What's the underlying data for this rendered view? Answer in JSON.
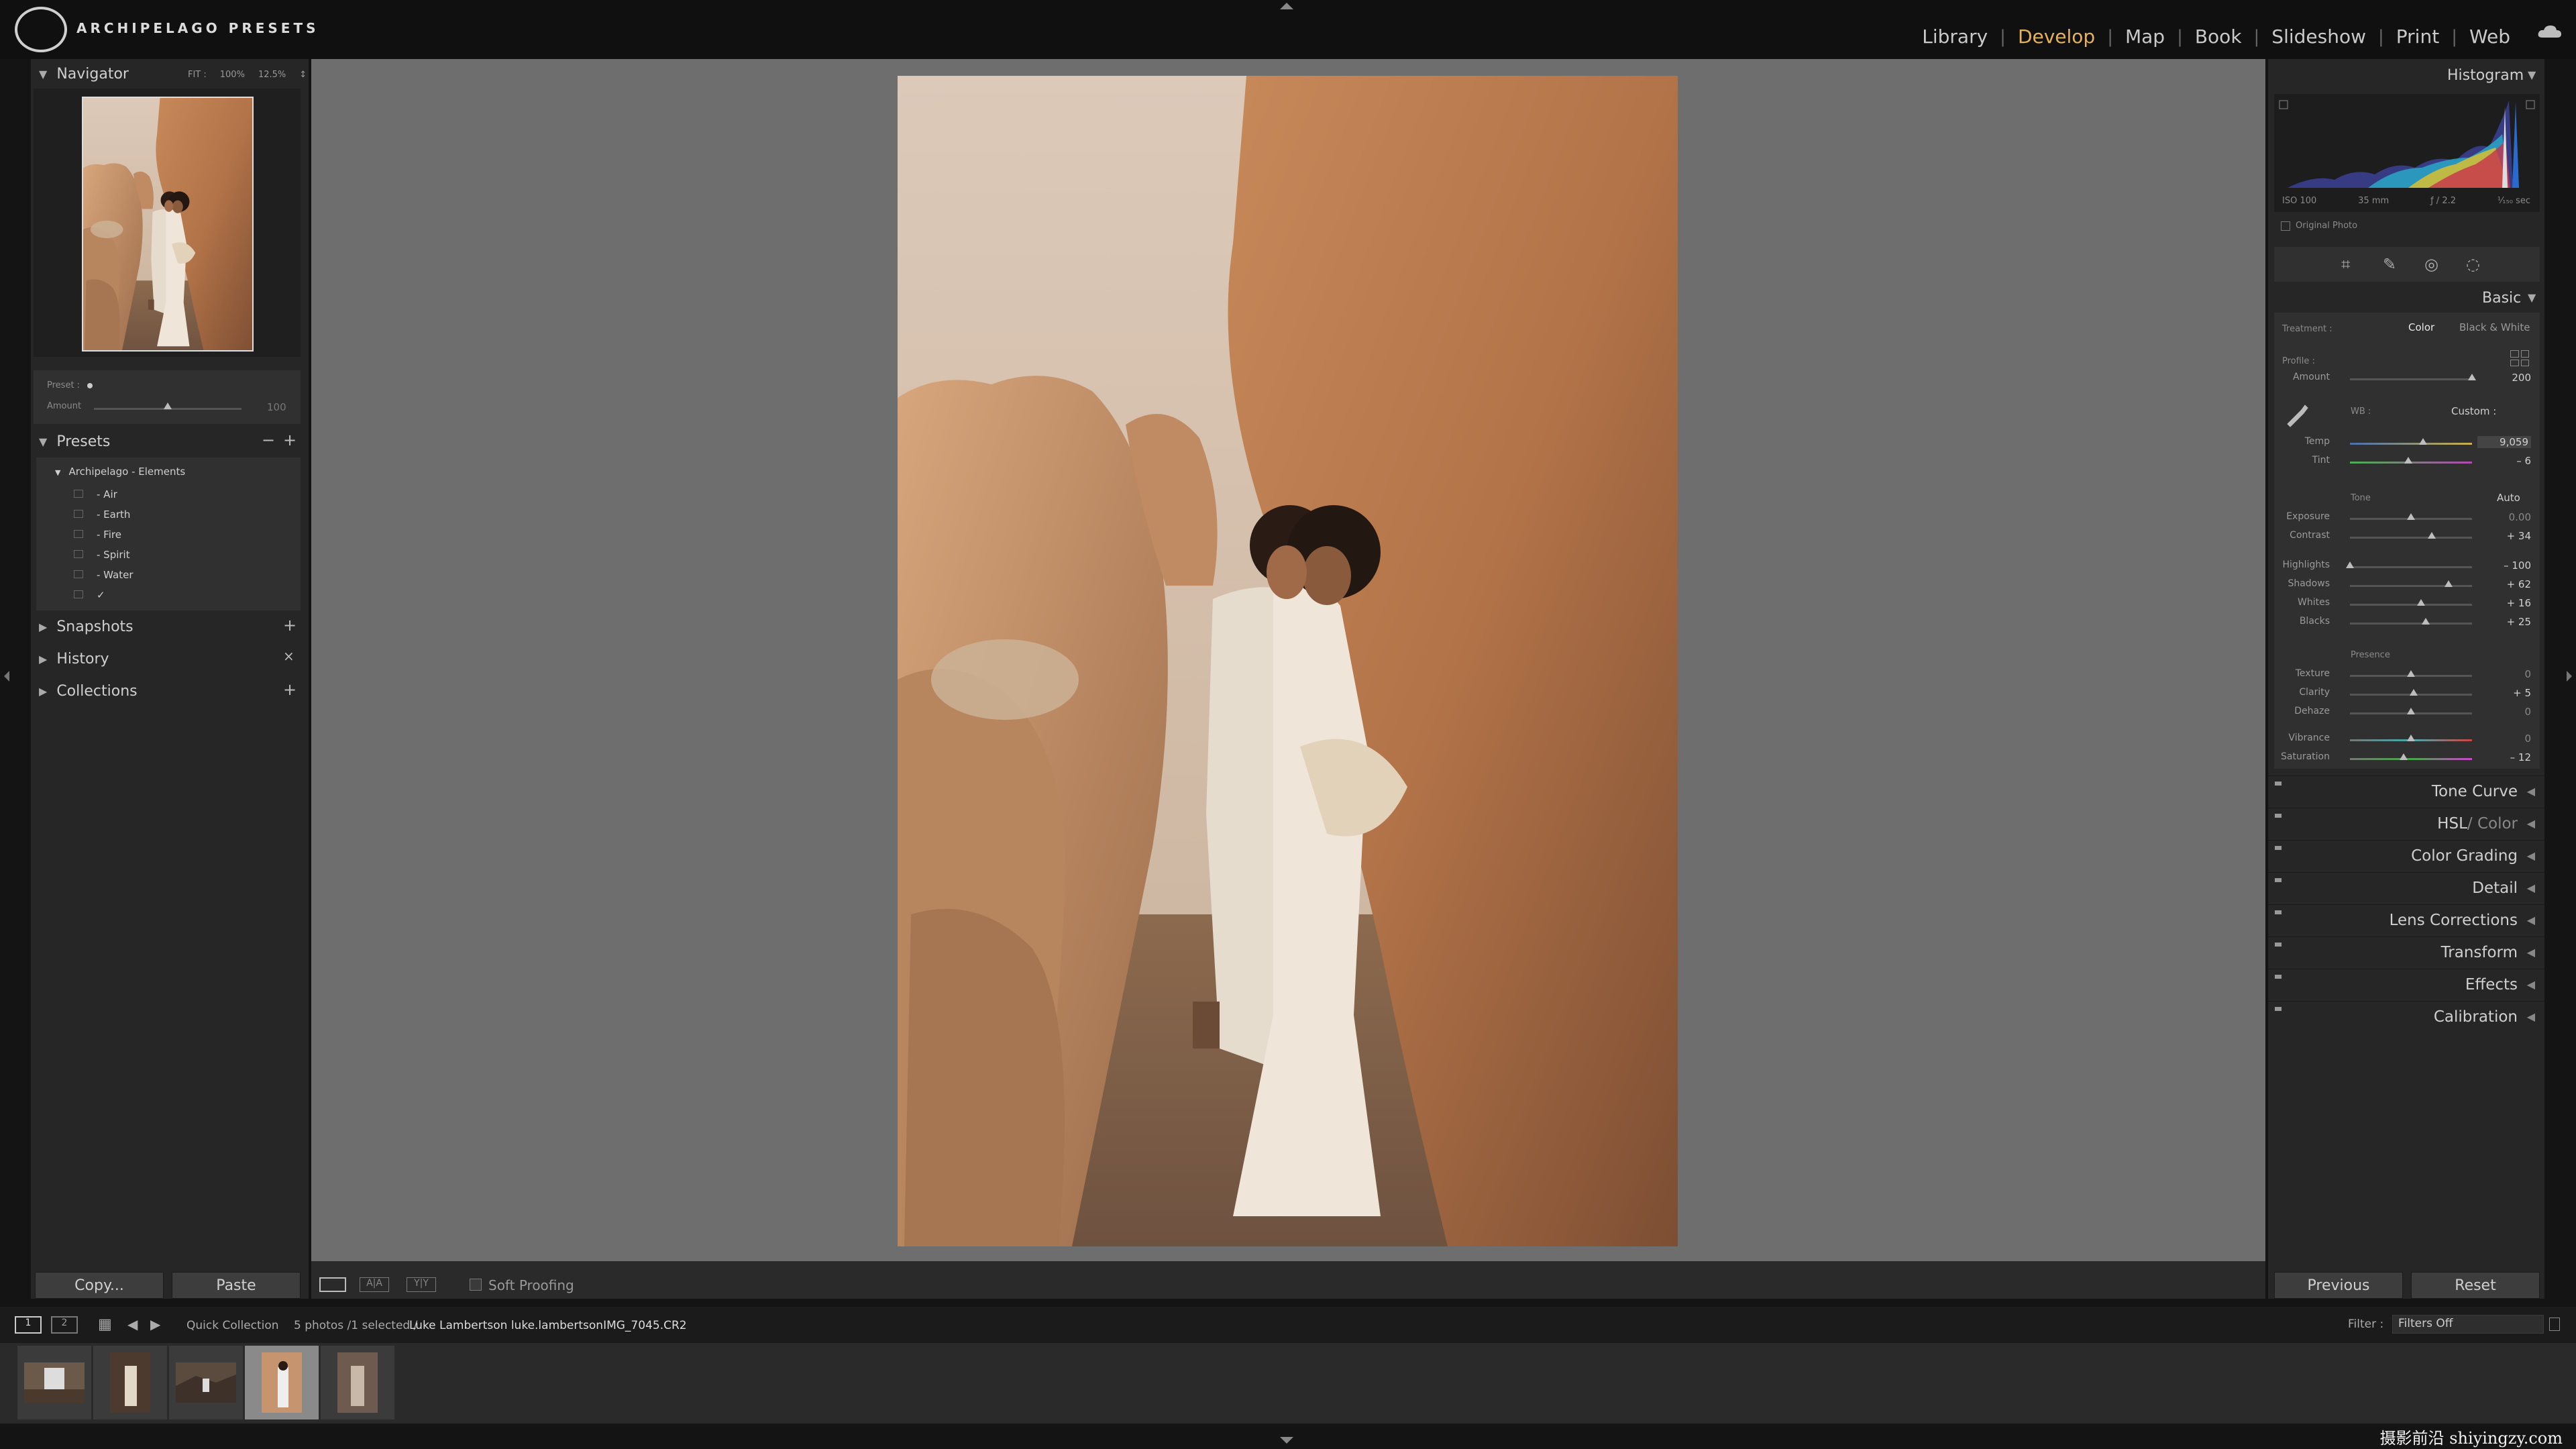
{
  "app": {
    "brand": "ARCHIPELAGO PRESETS",
    "logo_text": "ARCHIPELAGO PRESETS"
  },
  "modules": [
    {
      "label": "Library",
      "active": false
    },
    {
      "label": "Develop",
      "active": true
    },
    {
      "label": "Map",
      "active": false
    },
    {
      "label": "Book",
      "active": false
    },
    {
      "label": "Slideshow",
      "active": false
    },
    {
      "label": "Print",
      "active": false
    },
    {
      "label": "Web",
      "active": false
    }
  ],
  "navigator": {
    "title": "Navigator",
    "zoom_options": [
      "FIT :",
      "100%",
      "12.5%",
      "↕"
    ]
  },
  "preset_amount": {
    "preset_label": "Preset :",
    "amount_label": "Amount",
    "amount_value": "100",
    "amount_fraction": 0.5
  },
  "presets": {
    "title": "Presets",
    "group": "Archipelago - Elements",
    "items": [
      "- Air",
      "- Earth",
      "- Fire",
      "- Spirit",
      "- Water"
    ]
  },
  "sections": {
    "snapshots": "Snapshots",
    "history": "History",
    "collections": "Collections"
  },
  "left_buttons": {
    "copy": "Copy...",
    "paste": "Paste"
  },
  "toolbar": {
    "soft_proofing": "Soft Proofing"
  },
  "histogram": {
    "title": "Histogram",
    "iso": "ISO 100",
    "focal": "35 mm",
    "aperture": "ƒ / 2.2",
    "shutter": "¹⁄₁₅₀ sec",
    "original": "Original Photo"
  },
  "basic": {
    "title": "Basic",
    "treatment_label": "Treatment :",
    "treatment_color": "Color",
    "treatment_bw": "Black & White",
    "profile_label": "Profile :",
    "amount": {
      "label": "Amount",
      "value": "200",
      "fraction": 1.0
    },
    "wb_label": "WB :",
    "wb_value": "Custom :",
    "temp": {
      "label": "Temp",
      "value": "9,059",
      "fraction": 0.6
    },
    "tint": {
      "label": "Tint",
      "value": "– 6",
      "fraction": 0.48
    },
    "tone_label": "Tone",
    "auto_label": "Auto",
    "exposure": {
      "label": "Exposure",
      "value": "0.00",
      "fraction": 0.5
    },
    "contrast": {
      "label": "Contrast",
      "value": "+ 34",
      "fraction": 0.67
    },
    "highlights": {
      "label": "Highlights",
      "value": "– 100",
      "fraction": 0.0
    },
    "shadows": {
      "label": "Shadows",
      "value": "+ 62",
      "fraction": 0.81
    },
    "whites": {
      "label": "Whites",
      "value": "+ 16",
      "fraction": 0.58
    },
    "blacks": {
      "label": "Blacks",
      "value": "+ 25",
      "fraction": 0.62
    },
    "presence_label": "Presence",
    "texture": {
      "label": "Texture",
      "value": "0",
      "fraction": 0.5
    },
    "clarity": {
      "label": "Clarity",
      "value": "+ 5",
      "fraction": 0.52
    },
    "dehaze": {
      "label": "Dehaze",
      "value": "0",
      "fraction": 0.5
    },
    "vibrance": {
      "label": "Vibrance",
      "value": "0",
      "fraction": 0.5
    },
    "saturation": {
      "label": "Saturation",
      "value": "– 12",
      "fraction": 0.44
    }
  },
  "panels": [
    {
      "hsl_a": "HSL",
      "hsl_b": "/ Color"
    },
    "Tone Curve",
    "Color Grading",
    "Detail",
    "Lens Corrections",
    "Transform",
    "Effects",
    "Calibration"
  ],
  "right_buttons": {
    "previous": "Previous",
    "reset": "Reset"
  },
  "filmbar": {
    "page1": "1",
    "page2": "2",
    "source": "Quick Collection",
    "info": "5 photos /1 selected /",
    "filename": "Luke Lambertson luke.lambertsonIMG_7045.CR2",
    "filter_label": "Filter :",
    "filter_value": "Filters Off"
  },
  "watermark": "摄影前沿 shiyingzy.com"
}
